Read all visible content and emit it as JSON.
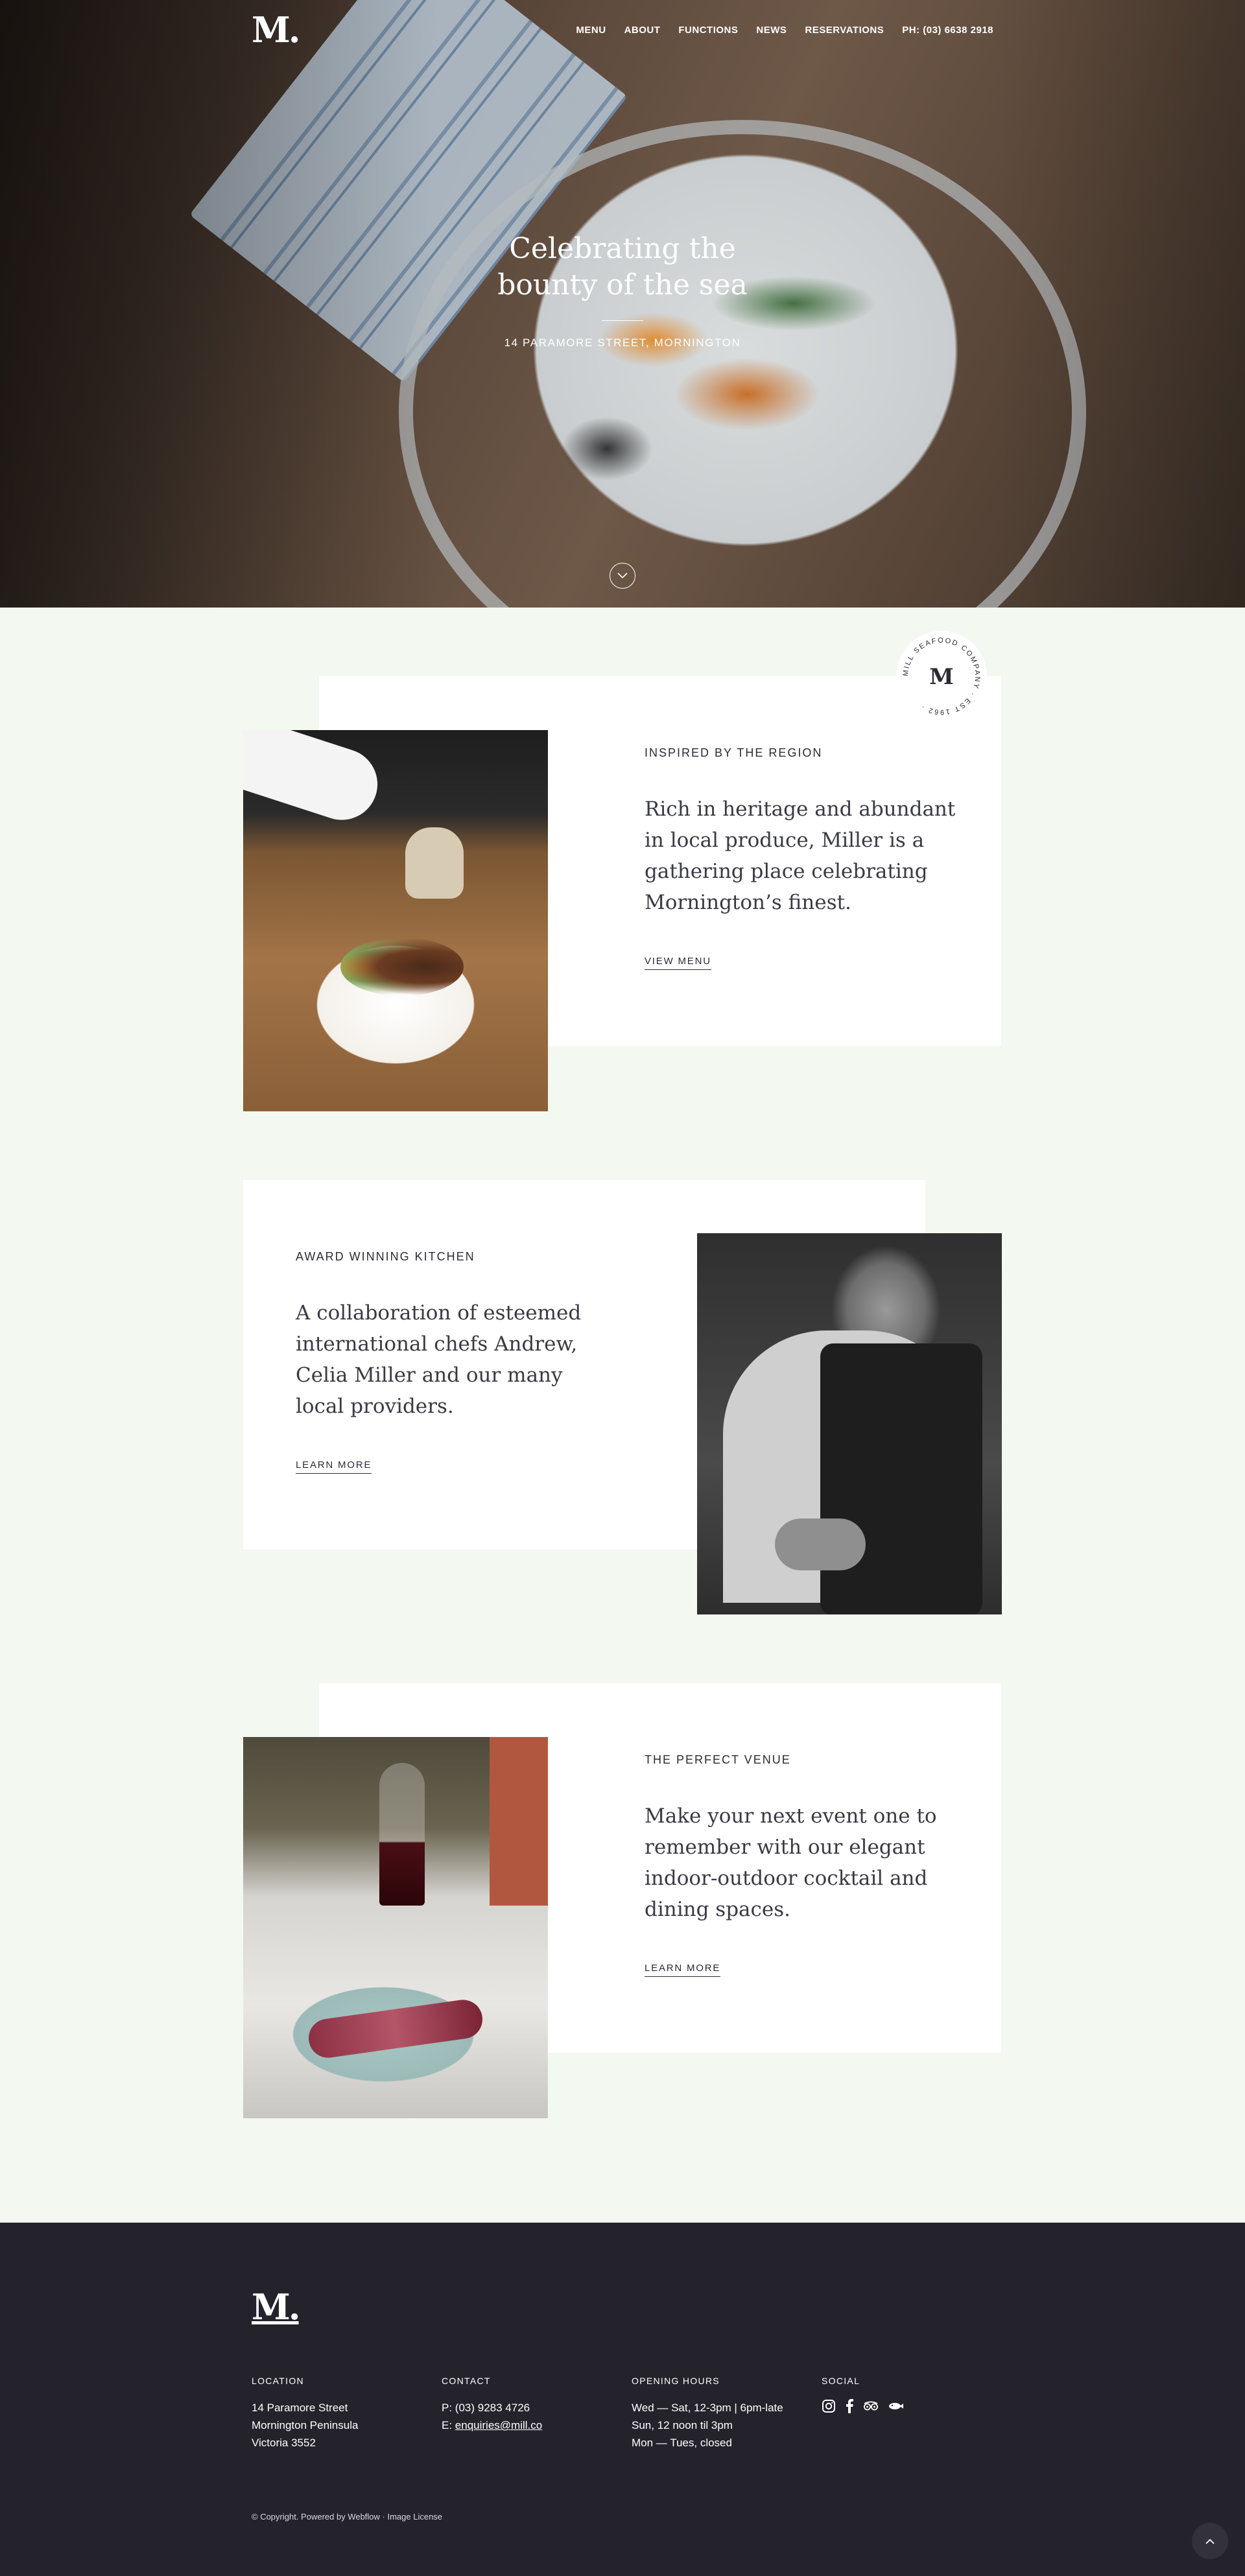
{
  "brand": {
    "logo": "M."
  },
  "nav": {
    "links": [
      "MENU",
      "ABOUT",
      "FUNCTIONS",
      "NEWS",
      "RESERVATIONS"
    ],
    "phone": "PH: (03) 6638 2918"
  },
  "hero": {
    "title": "Celebrating the bounty of the sea",
    "address": "14 PARAMORE STREET, MORNINGTON"
  },
  "badge": {
    "monogram": "M",
    "ring_text": "MILL SEAFOOD COMPANY · EST 1962 ·"
  },
  "features": [
    {
      "eyebrow": "INSPIRED BY THE REGION",
      "text": "Rich in heritage and abundant in local produce, Miller is a gathering place celebrating Mornington’s finest.",
      "link": "VIEW MENU"
    },
    {
      "eyebrow": "AWARD WINNING KITCHEN",
      "text": "A collaboration of esteemed international chefs Andrew, Celia Miller and our many local providers.",
      "link": "LEARN MORE"
    },
    {
      "eyebrow": "THE PERFECT VENUE",
      "text": "Make your next event one to remember with our elegant indoor-outdoor cocktail and dining spaces.",
      "link": "LEARN MORE"
    }
  ],
  "footer": {
    "logo": "M.",
    "location": {
      "heading": "LOCATION",
      "lines": [
        "14 Paramore Street",
        "Mornington Peninsula",
        "Victoria 3552"
      ]
    },
    "contact": {
      "heading": "CONTACT",
      "phone": "P: (03) 9283 4726",
      "email_prefix": "E: ",
      "email": "enquiries@mill.co"
    },
    "hours": {
      "heading": "OPENING HOURS",
      "lines": [
        "Wed — Sat, 12-3pm | 6pm-late",
        "Sun, 12 noon til 3pm",
        "Mon — Tues, closed"
      ]
    },
    "social": {
      "heading": "SOCIAL",
      "icons": [
        "instagram-icon",
        "facebook-icon",
        "tripadvisor-icon",
        "zomato-icon"
      ]
    },
    "copyright": "© Copyright. Powered by Webflow · Image License"
  },
  "colors": {
    "page_bg": "#f3f8f1",
    "card_bg": "#ffffff",
    "footer_bg": "#24232b",
    "text_dark": "#2b2b33"
  }
}
